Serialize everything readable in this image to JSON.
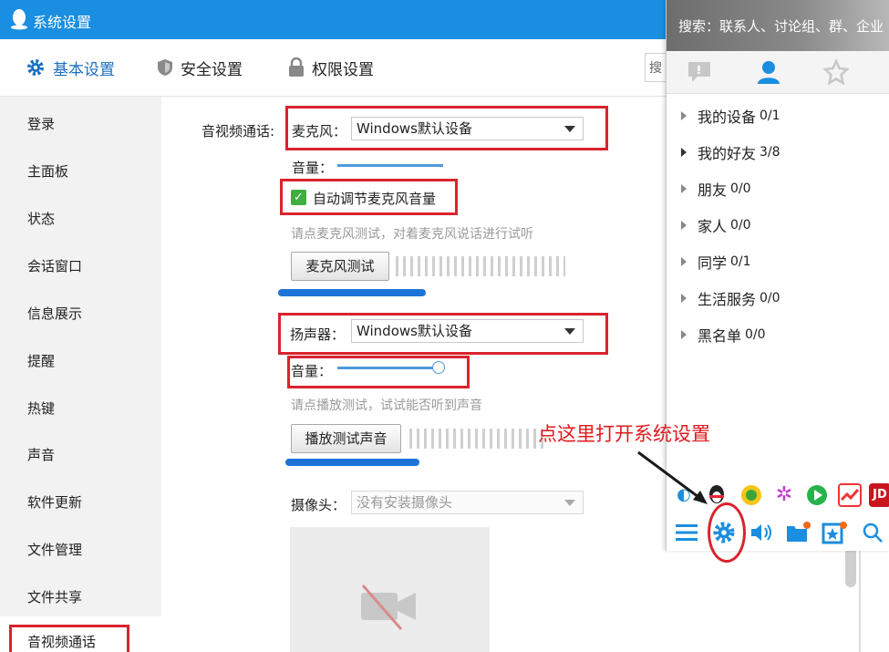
{
  "window": {
    "title": "系统设置"
  },
  "tabs": [
    {
      "label": "基本设置",
      "icon": "gear-icon",
      "active": true
    },
    {
      "label": "安全设置",
      "icon": "shield-icon"
    },
    {
      "label": "权限设置",
      "icon": "lock-icon"
    }
  ],
  "search_stub": "搜",
  "sidebar": {
    "items": [
      "登录",
      "主面板",
      "状态",
      "会话窗口",
      "信息展示",
      "提醒",
      "热键",
      "声音",
      "软件更新",
      "文件管理",
      "文件共享",
      "音视频通话"
    ],
    "active_index": 11
  },
  "av": {
    "section_label": "音视频通话:",
    "mic_label": "麦克风：",
    "mic_value": "Windows默认设备",
    "volume_label": "音量：",
    "auto_adjust_label": "自动调节麦克风音量",
    "auto_adjust_checked": true,
    "mic_hint": "请点麦克风测试，对着麦克风说话进行试听",
    "mic_test_button": "麦克风测试",
    "speaker_label": "扬声器：",
    "speaker_value": "Windows默认设备",
    "speaker_volume_label": "音量：",
    "speaker_volume_level": 0.95,
    "mic_volume_level": 1.0,
    "speaker_hint": "请点播放测试，试试能否听到声音",
    "play_test_button": "播放测试声音",
    "camera_label": "摄像头：",
    "camera_value": "没有安装摄像头"
  },
  "qq": {
    "search_text": "搜索：联系人、讨论组、群、企业",
    "tabs": [
      "message-icon",
      "contacts-icon",
      "favorites-icon"
    ],
    "groups": [
      {
        "name": "我的设备",
        "count": "0/1"
      },
      {
        "name": "我的好友",
        "count": "3/8"
      },
      {
        "name": "朋友",
        "count": "0/0"
      },
      {
        "name": "家人",
        "count": "0/0"
      },
      {
        "name": "同学",
        "count": "0/1"
      },
      {
        "name": "生活服务",
        "count": "0/0"
      },
      {
        "name": "黑名单",
        "count": "0/0"
      }
    ],
    "apps": [
      "browser-icon",
      "qq-penguin-icon",
      "music-icon",
      "flower-icon",
      "video-play-icon",
      "stock-icon",
      "jd-icon"
    ],
    "app_jd_text": "JD",
    "tools": [
      "menu-icon",
      "settings-gear-icon",
      "volume-icon",
      "folder-icon",
      "app-box-icon",
      "search-icon"
    ]
  },
  "annotation": {
    "text": "点这里打开系统设置"
  },
  "colors": {
    "titlebar": "#1a8ee0",
    "highlight": "#d9232d",
    "ink": "#1e73d8",
    "check": "#3fae3f"
  }
}
